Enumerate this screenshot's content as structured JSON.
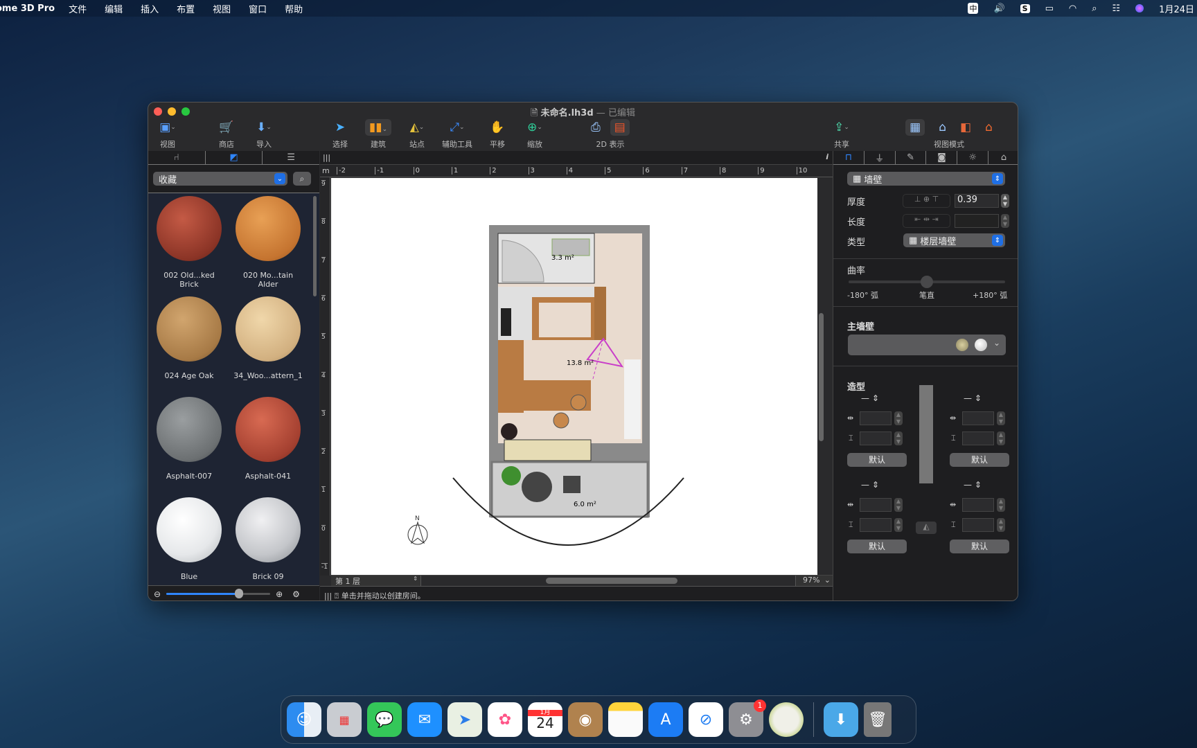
{
  "menubar": {
    "app": "ome 3D Pro",
    "items": [
      "文件",
      "编辑",
      "插入",
      "布置",
      "视图",
      "窗口",
      "帮助"
    ],
    "clock": "1月24日",
    "input_method": "中"
  },
  "window": {
    "title": "未命名.lh3d",
    "separator": "—",
    "status": "已编辑"
  },
  "toolbar": {
    "view": "视图",
    "store": "商店",
    "import": "导入",
    "select": "选择",
    "build": "建筑",
    "site": "站点",
    "aux": "辅助工具",
    "pan": "平移",
    "zoom": "缩放",
    "display2d": "2D 表示",
    "share": "共享",
    "view_mode": "视图模式"
  },
  "left_panel": {
    "category": "收藏",
    "materials": [
      "002 Old...ked Brick",
      "020 Mo...tain Alder",
      "024 Age Oak",
      "34_Woo...attern_1",
      "Asphalt-007",
      "Asphalt-041",
      "Blue",
      "Brick 09"
    ],
    "thumb_size_fraction": 0.7
  },
  "plan": {
    "unit": "m",
    "h_ticks": [
      "-2",
      "-1",
      "0",
      "1",
      "2",
      "3",
      "4",
      "5",
      "6",
      "7",
      "8",
      "9",
      "10"
    ],
    "v_ticks": [
      "9",
      "8",
      "7",
      "6",
      "5",
      "4",
      "3",
      "2",
      "1",
      "0",
      "-1"
    ],
    "rooms": [
      {
        "area": "3.3 m²"
      },
      {
        "area": "13.8 m²"
      },
      {
        "area": "6.0 m²"
      }
    ],
    "compass": "N",
    "level": "第 1 层",
    "zoom": "97%",
    "hint": "单击并拖动以创建房间。",
    "info": "i"
  },
  "inspector": {
    "object": "墙壁",
    "thickness_label": "厚度",
    "thickness": "0.39",
    "length_label": "长度",
    "type_label": "类型",
    "type": "楼层墙壁",
    "curvature_label": "曲率",
    "curv_min": "-180° 弧",
    "curv_mid": "笔直",
    "curv_max": "+180° 弧",
    "curvature_fraction": 0.5,
    "main_wall_label": "主墙壁",
    "profile_label": "造型",
    "default": "默认"
  },
  "dock": {
    "apps": [
      "Finder",
      "Launchpad",
      "Messages",
      "Mail",
      "Maps",
      "Photos",
      "Calendar",
      "Contacts",
      "Notes",
      "App Store",
      "Safari",
      "System Preferences",
      "Live Home 3D",
      "Downloads",
      "Trash"
    ],
    "calendar_month": "1月",
    "calendar_day": "24",
    "badge": "1"
  },
  "colors": {
    "accent": "#2f86ff",
    "floor": "#e9dbcf",
    "wood": "#b97b43"
  }
}
